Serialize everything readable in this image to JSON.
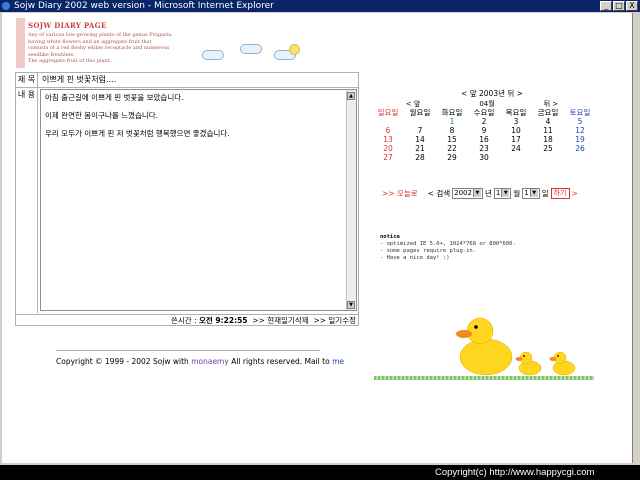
{
  "window": {
    "title": "Sojw Diary 2002 web version - Microsoft Internet Explorer",
    "buttons": [
      "_",
      "□",
      "X"
    ]
  },
  "banner": {
    "title": "SOJW DIARY PAGE",
    "lines": [
      "Any of various low-growing plants of the genus Fragaria,",
      "having white flowers and an aggregate fruit that",
      "consists of a red fleshy edible receptacle and numerous",
      "seedlike freuhlets.",
      "The aggregate fruit of this plant."
    ]
  },
  "diary": {
    "title_label": "제 목",
    "title_value": "이쁘게 핀 벗꽃처럼....",
    "body_label": "내 용",
    "body_lines": [
      "아침 출근길에 이쁘게 핀 벗꽃을 보았습니다.",
      "",
      "이제 완연한 봄이구나를 느꼈습니다.",
      "",
      "우리 모두가 이쁘게 핀 저 벗꽃처럼 행복했으면 좋겠습니다."
    ],
    "written_label": "쓴시간 :",
    "written_time": "오전 9:22:55",
    "delete_link": ">> 현재일기삭제",
    "edit_link": ">> 일기수정"
  },
  "footer": {
    "copy_pre": "Copyright © 1999 - 2002 Sojw with",
    "copy_name": "monaemy",
    "copy_mid": "All rights reserved. Mail to",
    "copy_mail": "me"
  },
  "calendar": {
    "year_nav": "< 앞  2003년 뒤 >",
    "prev_month": "< 앞",
    "month": "04월",
    "next_month": "뒤 >",
    "weekdays": [
      "일요일",
      "월요일",
      "화요일",
      "수요일",
      "목요일",
      "금요일",
      "토요일"
    ],
    "weeks": [
      [
        "",
        "",
        "1",
        "2",
        "3",
        "4",
        "5"
      ],
      [
        "6",
        "7",
        "8",
        "9",
        "10",
        "11",
        "12"
      ],
      [
        "13",
        "14",
        "15",
        "16",
        "17",
        "18",
        "19"
      ],
      [
        "20",
        "21",
        "22",
        "23",
        "24",
        "25",
        "26"
      ],
      [
        "27",
        "28",
        "29",
        "30",
        "",
        "",
        ""
      ]
    ],
    "today_link": ">> 오늘로",
    "search_label": "< 검색",
    "year_value": "2002",
    "year_unit": "년",
    "month_value": "1",
    "month_unit": "월",
    "day_value": "1",
    "day_unit": "일",
    "go_button": "하기",
    "go_arrow": ">"
  },
  "notice": {
    "title": "notice",
    "lines": [
      "- optimized IE 5.0+, 1024*768 or 800*600.",
      "- some pages require plug-in.",
      "- Have a nice day! :)"
    ]
  },
  "status": {
    "text": "Copyright(c) http://www.happycgi.com"
  },
  "colors": {
    "titlebar": "#0a246a",
    "sunday": "#e03030",
    "saturday": "#2040c0",
    "today": "#20a020"
  }
}
